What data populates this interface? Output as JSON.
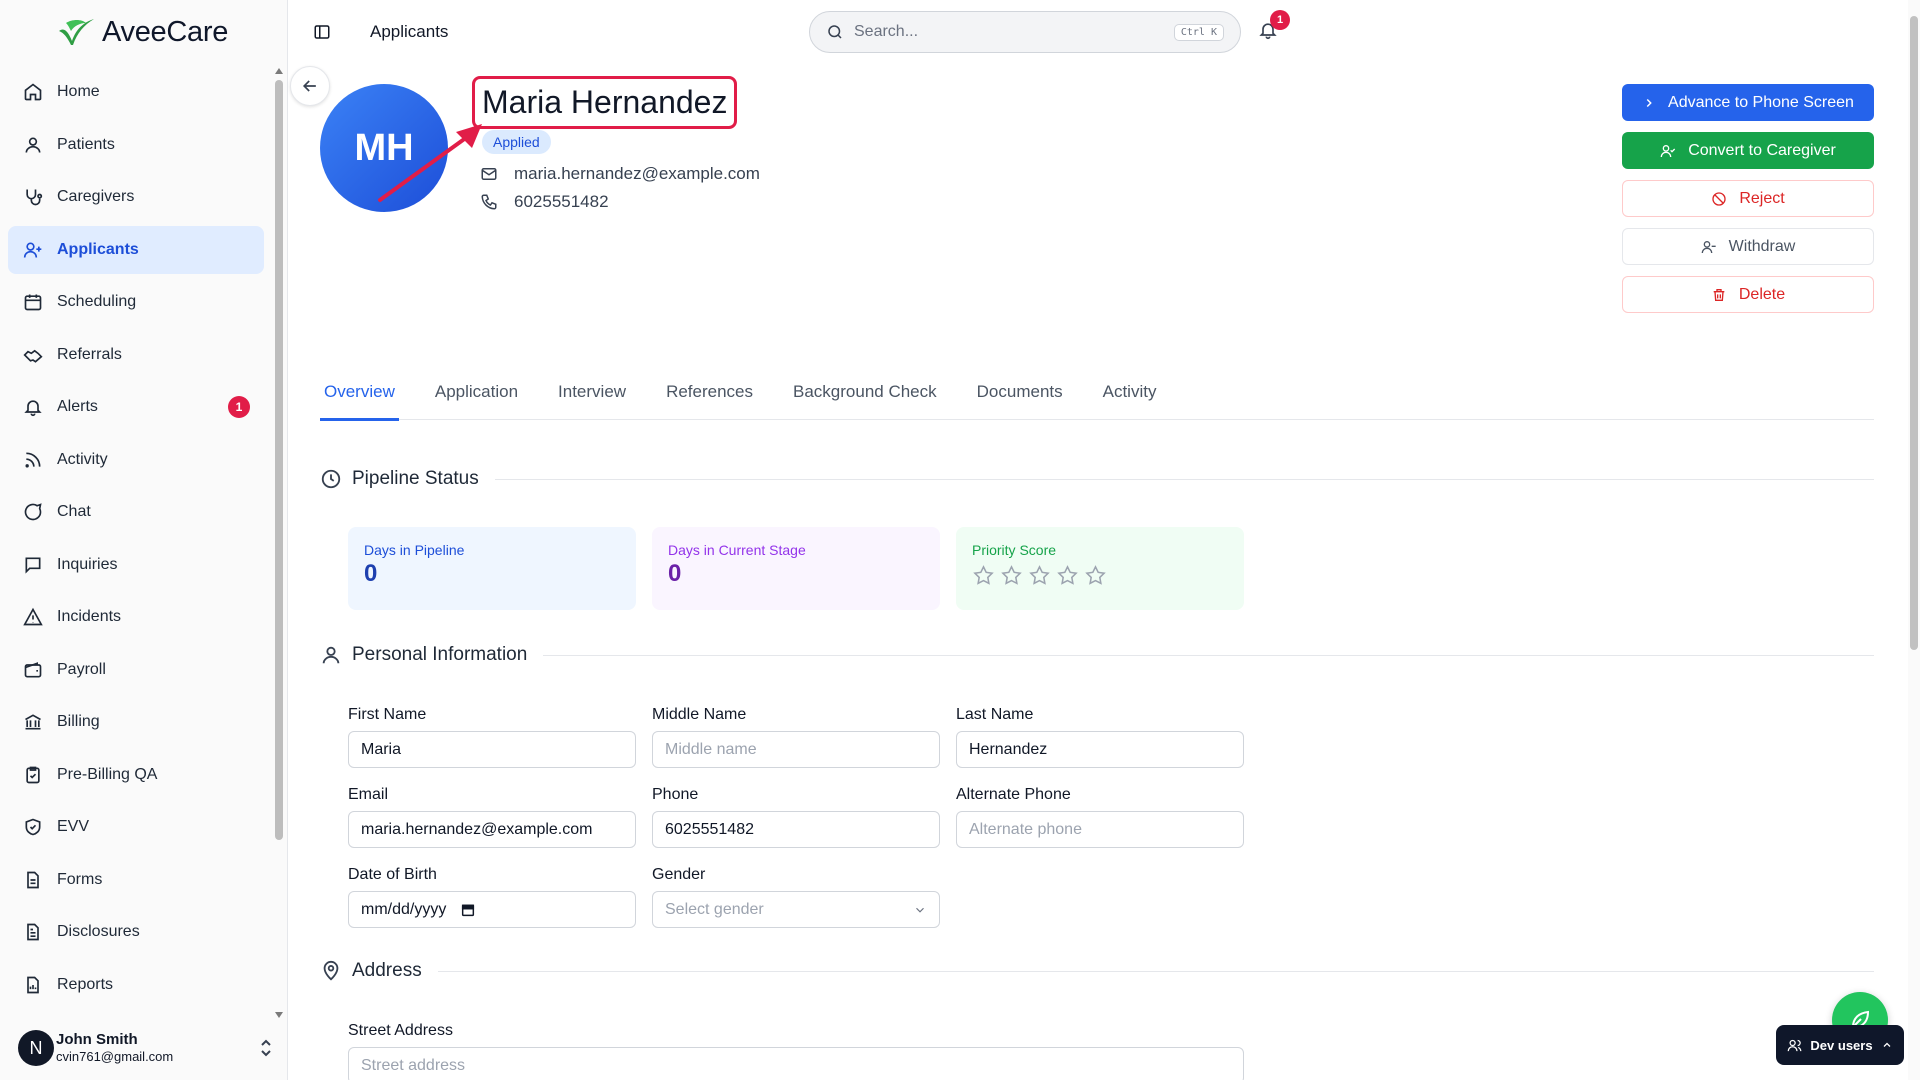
{
  "app": {
    "brand": "AveeCare"
  },
  "sidebar": {
    "items": [
      {
        "label": "Home",
        "icon": "home-icon"
      },
      {
        "label": "Patients",
        "icon": "user-icon"
      },
      {
        "label": "Caregivers",
        "icon": "stethoscope-icon"
      },
      {
        "label": "Applicants",
        "icon": "user-plus-icon",
        "active": true
      },
      {
        "label": "Scheduling",
        "icon": "calendar-icon"
      },
      {
        "label": "Referrals",
        "icon": "handshake-icon"
      },
      {
        "label": "Alerts",
        "icon": "bell-icon",
        "badge": "1"
      },
      {
        "label": "Activity",
        "icon": "rss-icon"
      },
      {
        "label": "Chat",
        "icon": "chat-icon"
      },
      {
        "label": "Inquiries",
        "icon": "message-square-icon"
      },
      {
        "label": "Incidents",
        "icon": "alert-triangle-icon"
      },
      {
        "label": "Payroll",
        "icon": "wallet-icon"
      },
      {
        "label": "Billing",
        "icon": "bank-icon"
      },
      {
        "label": "Pre-Billing QA",
        "icon": "clipboard-check-icon"
      },
      {
        "label": "EVV",
        "icon": "shield-check-icon"
      },
      {
        "label": "Forms",
        "icon": "file-icon"
      },
      {
        "label": "Disclosures",
        "icon": "file-text-icon"
      },
      {
        "label": "Reports",
        "icon": "report-icon"
      }
    ],
    "user": {
      "initial": "N",
      "name": "John Smith",
      "email": "cvin761@gmail.com"
    }
  },
  "header": {
    "page": "Applicants",
    "search": {
      "placeholder": "Search...",
      "shortcut": "Ctrl K"
    },
    "notifications": "1"
  },
  "applicant": {
    "initials": "MH",
    "name": "Maria Hernandez",
    "status": "Applied",
    "email": "maria.hernandez@example.com",
    "phone": "6025551482"
  },
  "actions": {
    "advance": "Advance to Phone Screen",
    "convert": "Convert to Caregiver",
    "reject": "Reject",
    "withdraw": "Withdraw",
    "delete": "Delete"
  },
  "tabs": [
    "Overview",
    "Application",
    "Interview",
    "References",
    "Background Check",
    "Documents",
    "Activity"
  ],
  "pipeline": {
    "title": "Pipeline Status",
    "days_in_pipeline": {
      "label": "Days in Pipeline",
      "value": "0"
    },
    "days_in_stage": {
      "label": "Days in Current Stage",
      "value": "0"
    },
    "priority": {
      "label": "Priority Score",
      "stars_filled": 0,
      "stars_total": 5
    }
  },
  "personal": {
    "title": "Personal Information",
    "first_name": {
      "label": "First Name",
      "value": "Maria"
    },
    "middle_name": {
      "label": "Middle Name",
      "placeholder": "Middle name"
    },
    "last_name": {
      "label": "Last Name",
      "value": "Hernandez"
    },
    "email": {
      "label": "Email",
      "value": "maria.hernandez@example.com"
    },
    "phone": {
      "label": "Phone",
      "value": "6025551482"
    },
    "alt_phone": {
      "label": "Alternate Phone",
      "placeholder": "Alternate phone"
    },
    "dob": {
      "label": "Date of Birth",
      "placeholder": "mm/dd/yyyy"
    },
    "gender": {
      "label": "Gender",
      "placeholder": "Select gender"
    }
  },
  "address": {
    "title": "Address",
    "street": {
      "label": "Street Address",
      "placeholder": "Street address"
    }
  },
  "dev": {
    "label": "Dev users"
  },
  "colors": {
    "primary": "#2563eb",
    "success": "#16a34a",
    "danger": "#dc2626",
    "annotation": "#e11d48"
  }
}
